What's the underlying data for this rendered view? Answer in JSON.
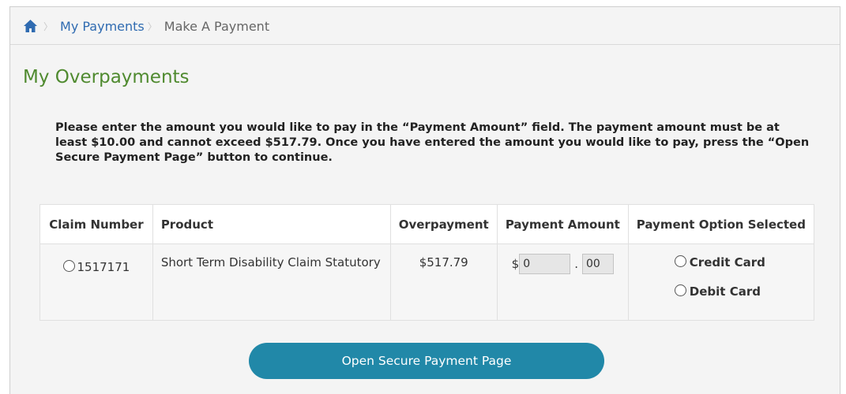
{
  "breadcrumb": {
    "home_icon": "home-icon",
    "items": [
      "My Payments",
      "Make A Payment"
    ]
  },
  "page": {
    "title": "My Overpayments",
    "instructions": "Please enter the amount you would like to pay in the “Payment Amount” field. The payment amount must be at least $10.00 and cannot exceed $517.79. Once you have entered the amount you would like to pay, press the “Open Secure Payment Page” button to continue."
  },
  "table": {
    "headers": [
      "Claim Number",
      "Product",
      "Overpayment",
      "Payment Amount",
      "Payment Option Selected"
    ],
    "row": {
      "claim_number": "1517171",
      "product": "Short Term Disability Claim Statutory",
      "overpayment": "$517.79",
      "currency_symbol": "$",
      "amount_dollars": "0",
      "amount_cents": "00",
      "decimal_point": ".",
      "options": [
        "Credit Card",
        "Debit Card"
      ]
    }
  },
  "actions": {
    "open_secure_payment": "Open Secure Payment Page"
  },
  "colors": {
    "link": "#2f6bb1",
    "title": "#4f8a2f",
    "button": "#2188a8"
  }
}
